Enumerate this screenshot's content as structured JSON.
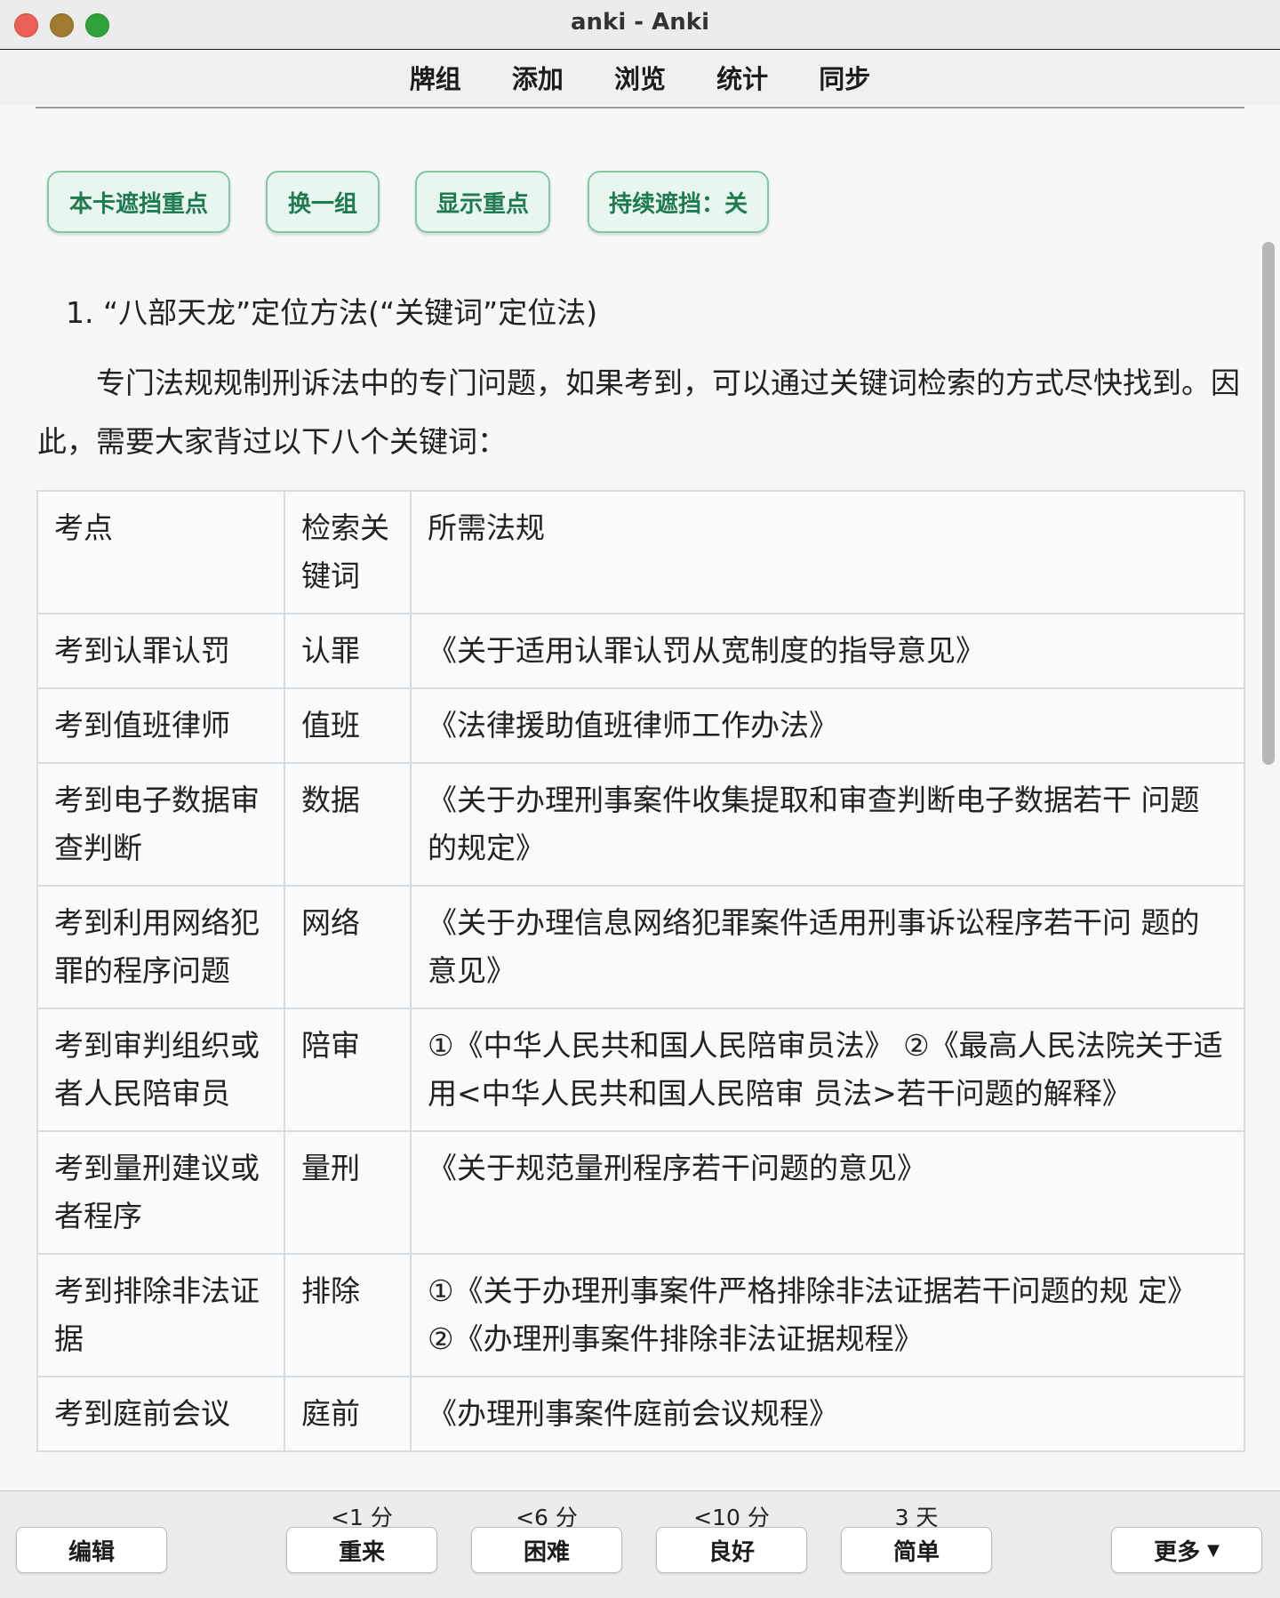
{
  "window": {
    "title": "anki - Anki"
  },
  "toolbar": {
    "items": [
      "牌组",
      "添加",
      "浏览",
      "统计",
      "同步"
    ]
  },
  "mask_buttons": [
    "本卡遮挡重点",
    "换一组",
    "显示重点",
    "持续遮挡：关"
  ],
  "card": {
    "heading": "1. “八部天龙”定位方法(“关键词”定位法)",
    "paragraph": "专门法规规制刑诉法中的专门问题，如果考到，可以通过关键词检索的方式尽快找到。因此，需要大家背过以下八个关键词：",
    "table": {
      "headers": [
        "考点",
        "检索关键词",
        "所需法规"
      ],
      "rows": [
        [
          "考到认罪认罚",
          "认罪",
          "《关于适用认罪认罚从宽制度的指导意见》"
        ],
        [
          "考到值班律师",
          "值班",
          "《法律援助值班律师工作办法》"
        ],
        [
          "考到电子数据审查判断",
          "数据",
          "《关于办理刑事案件收集提取和审查判断电子数据若干 问题的规定》"
        ],
        [
          "考到利用网络犯罪的程序问题",
          "网络",
          "《关于办理信息网络犯罪案件适用刑事诉讼程序若干问 题的意见》"
        ],
        [
          "考到审判组织或者人民陪审员",
          "陪审",
          "①《中华人民共和国人民陪审员法》 ②《最高人民法院关于适用<中华人民共和国人民陪审 员法>若干问题的解释》"
        ],
        [
          "考到量刑建议或者程序",
          "量刑",
          "《关于规范量刑程序若干问题的意见》"
        ],
        [
          "考到排除非法证据",
          "排除",
          "①《关于办理刑事案件严格排除非法证据若干问题的规 定》 ②《办理刑事案件排除非法证据规程》"
        ],
        [
          "考到庭前会议",
          "庭前",
          "《办理刑事案件庭前会议规程》"
        ]
      ]
    }
  },
  "bottom": {
    "edit": "编辑",
    "more": "更多",
    "answers": [
      {
        "interval": "<1 分",
        "label": "重来"
      },
      {
        "interval": "<6 分",
        "label": "困难"
      },
      {
        "interval": "<10 分",
        "label": "良好"
      },
      {
        "interval": "3 天",
        "label": "简单"
      }
    ]
  },
  "colors": {
    "mask_button_bg": "#e9f5ef",
    "mask_button_border": "#7ec8a5",
    "mask_button_text": "#1e7a4f"
  }
}
